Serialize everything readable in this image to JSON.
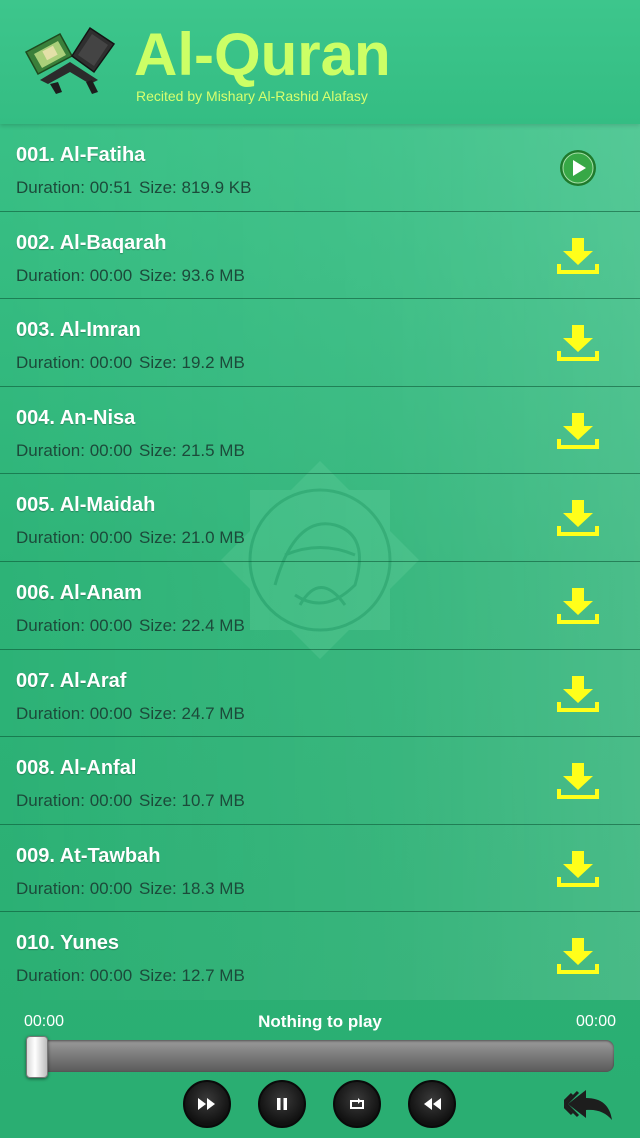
{
  "header": {
    "title": "Al-Quran",
    "subtitle": "Recited by Mishary Al-Rashid Alafasy"
  },
  "surahs": [
    {
      "name": "001. Al-Fatiha",
      "duration": "Duration: 00:51",
      "size": "Size: 819.9 KB",
      "action": "play-icon"
    },
    {
      "name": "002. Al-Baqarah",
      "duration": "Duration: 00:00",
      "size": "Size: 93.6 MB",
      "action": "download-icon"
    },
    {
      "name": "003. Al-Imran",
      "duration": "Duration: 00:00",
      "size": "Size: 19.2 MB",
      "action": "download-icon"
    },
    {
      "name": "004. An-Nisa",
      "duration": "Duration: 00:00",
      "size": "Size: 21.5 MB",
      "action": "download-icon"
    },
    {
      "name": "005. Al-Maidah",
      "duration": "Duration: 00:00",
      "size": "Size: 21.0 MB",
      "action": "download-icon"
    },
    {
      "name": "006. Al-Anam",
      "duration": "Duration: 00:00",
      "size": "Size: 22.4 MB",
      "action": "download-icon"
    },
    {
      "name": "007. Al-Araf",
      "duration": "Duration: 00:00",
      "size": "Size: 24.7 MB",
      "action": "download-icon"
    },
    {
      "name": "008. Al-Anfal",
      "duration": "Duration: 00:00",
      "size": "Size: 10.7 MB",
      "action": "download-icon"
    },
    {
      "name": "009. At-Tawbah",
      "duration": "Duration: 00:00",
      "size": "Size: 18.3 MB",
      "action": "download-icon"
    },
    {
      "name": "010. Yunes",
      "duration": "Duration: 00:00",
      "size": "Size: 12.7 MB",
      "action": "download-icon"
    }
  ],
  "player": {
    "current_time": "00:00",
    "total_time": "00:00",
    "status": "Nothing to play",
    "progress": 0,
    "controls": [
      "fast-forward-icon",
      "pause-icon",
      "repeat-icon",
      "rewind-icon"
    ]
  },
  "colors": {
    "background": "#2fb87c",
    "title": "#ccff66",
    "download": "#ffff1a",
    "play_button": "#2e9a3c"
  }
}
